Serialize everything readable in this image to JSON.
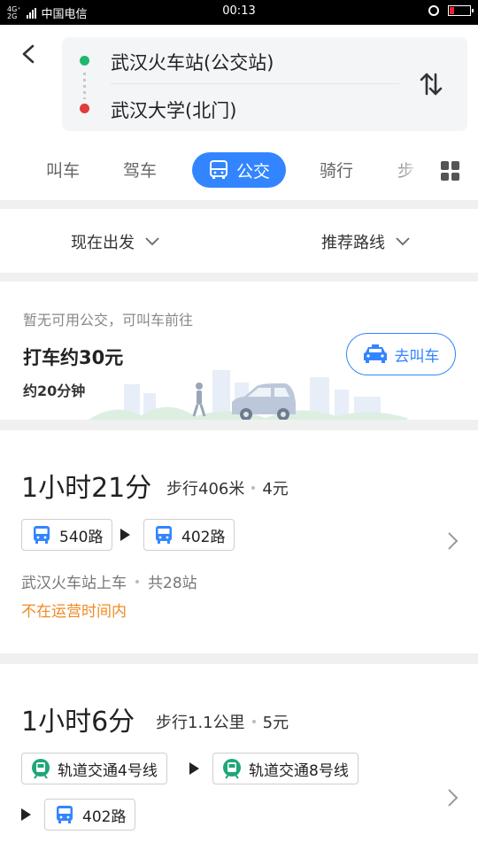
{
  "status_bar": {
    "network_top": "4G⁺",
    "network_bottom": "2G",
    "carrier": "中国电信",
    "time": "00:13"
  },
  "route": {
    "from": "武汉火车站(公交站)",
    "to": "武汉大学(北门)"
  },
  "tabs": {
    "call": "叫车",
    "drive": "驾车",
    "bus": "公交",
    "ride": "骑行",
    "walk": "步"
  },
  "filters": {
    "depart": "现在出发",
    "sort": "推荐路线"
  },
  "taxi": {
    "note": "暂无可用公交，可叫车前往",
    "price": "打车约30元",
    "duration": "约20分钟",
    "button": "去叫车"
  },
  "routes": [
    {
      "duration": "1小时21分",
      "walk": "步行406米",
      "fare": "4元",
      "legs": [
        "540路",
        "402路"
      ],
      "board": "武汉火车站上车",
      "stops": "共28站",
      "warning": "不在运营时间内"
    },
    {
      "duration": "1小时6分",
      "walk": "步行1.1公里",
      "fare": "5元",
      "legs": [
        "轨道交通4号线",
        "轨道交通8号线",
        "402路"
      ]
    }
  ],
  "colors": {
    "accent": "#3385ff",
    "origin": "#1fb76b",
    "destination": "#e23b3b",
    "metro": "#1fa67a",
    "warning": "#f08a24"
  },
  "icons": {
    "bus": "bus-icon",
    "metro": "metro-icon",
    "taxi": "taxi-icon"
  }
}
